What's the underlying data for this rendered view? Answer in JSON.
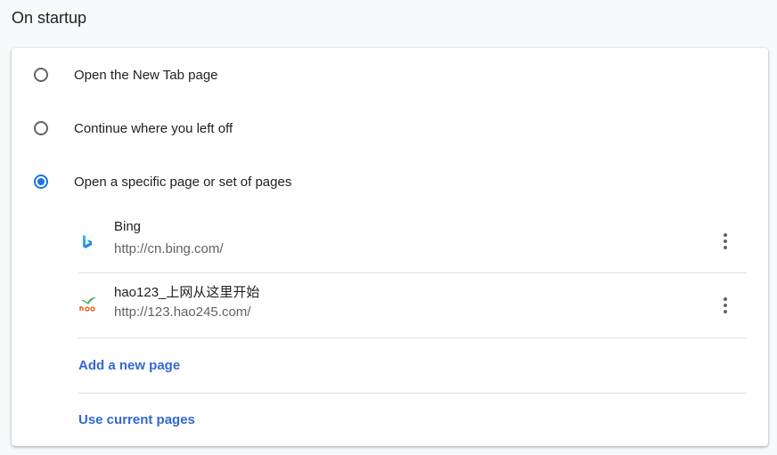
{
  "section": {
    "title": "On startup"
  },
  "options": [
    {
      "label": "Open the New Tab page",
      "selected": false
    },
    {
      "label": "Continue where you left off",
      "selected": false
    },
    {
      "label": "Open a specific page or set of pages",
      "selected": true
    }
  ],
  "pages": [
    {
      "name": "Bing",
      "url": "http://cn.bing.com/",
      "icon": "bing-favicon"
    },
    {
      "name": "hao123_上网从这里开始",
      "url": "http://123.hao245.com/",
      "icon": "hao123-favicon"
    }
  ],
  "actions": {
    "add_page": "Add a new page",
    "use_current": "Use current pages"
  },
  "colors": {
    "accent": "#1a73e8",
    "link": "#3367d6",
    "text": "#202124",
    "secondary_text": "#5f6368"
  }
}
